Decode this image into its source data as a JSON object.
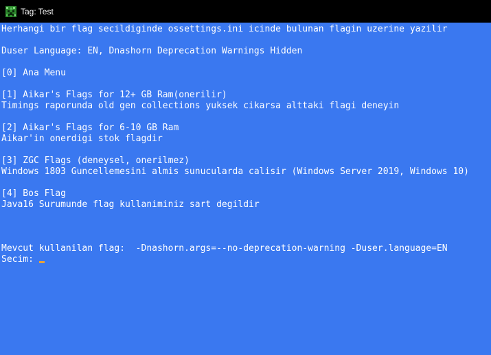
{
  "window": {
    "title": "Tag: Test",
    "icon": "minecraft-creeper-icon"
  },
  "console": {
    "lines": [
      "Herhangi bir flag secildiginde ossettings.ini icinde bulunan flagin uzerine yazilir",
      "",
      "Duser Language: EN, Dnashorn Deprecation Warnings Hidden",
      "",
      "[0] Ana Menu",
      "",
      "[1] Aikar's Flags for 12+ GB Ram(onerilir)",
      "Timings raporunda old gen collections yuksek cikarsa alttaki flagi deneyin",
      "",
      "[2] Aikar's Flags for 6-10 GB Ram",
      "Aikar'in onerdigi stok flagdir",
      "",
      "[3] ZGC Flags (deneysel, onerilmez)",
      "Windows 1803 Guncellemesini almis sunucularda calisir (Windows Server 2019, Windows 10)",
      "",
      "[4] Bos Flag",
      "Java16 Surumunde flag kullaniminiz sart degildir",
      "",
      "",
      "",
      "Mevcut kullanilan flag:  -Dnashorn.args=--no-deprecation-warning -Duser.language=EN",
      "Secim: "
    ]
  },
  "colors": {
    "background": "#3a78f0",
    "text": "#ffffff",
    "titlebar": "#000000",
    "cursor": "#e8a23a"
  }
}
